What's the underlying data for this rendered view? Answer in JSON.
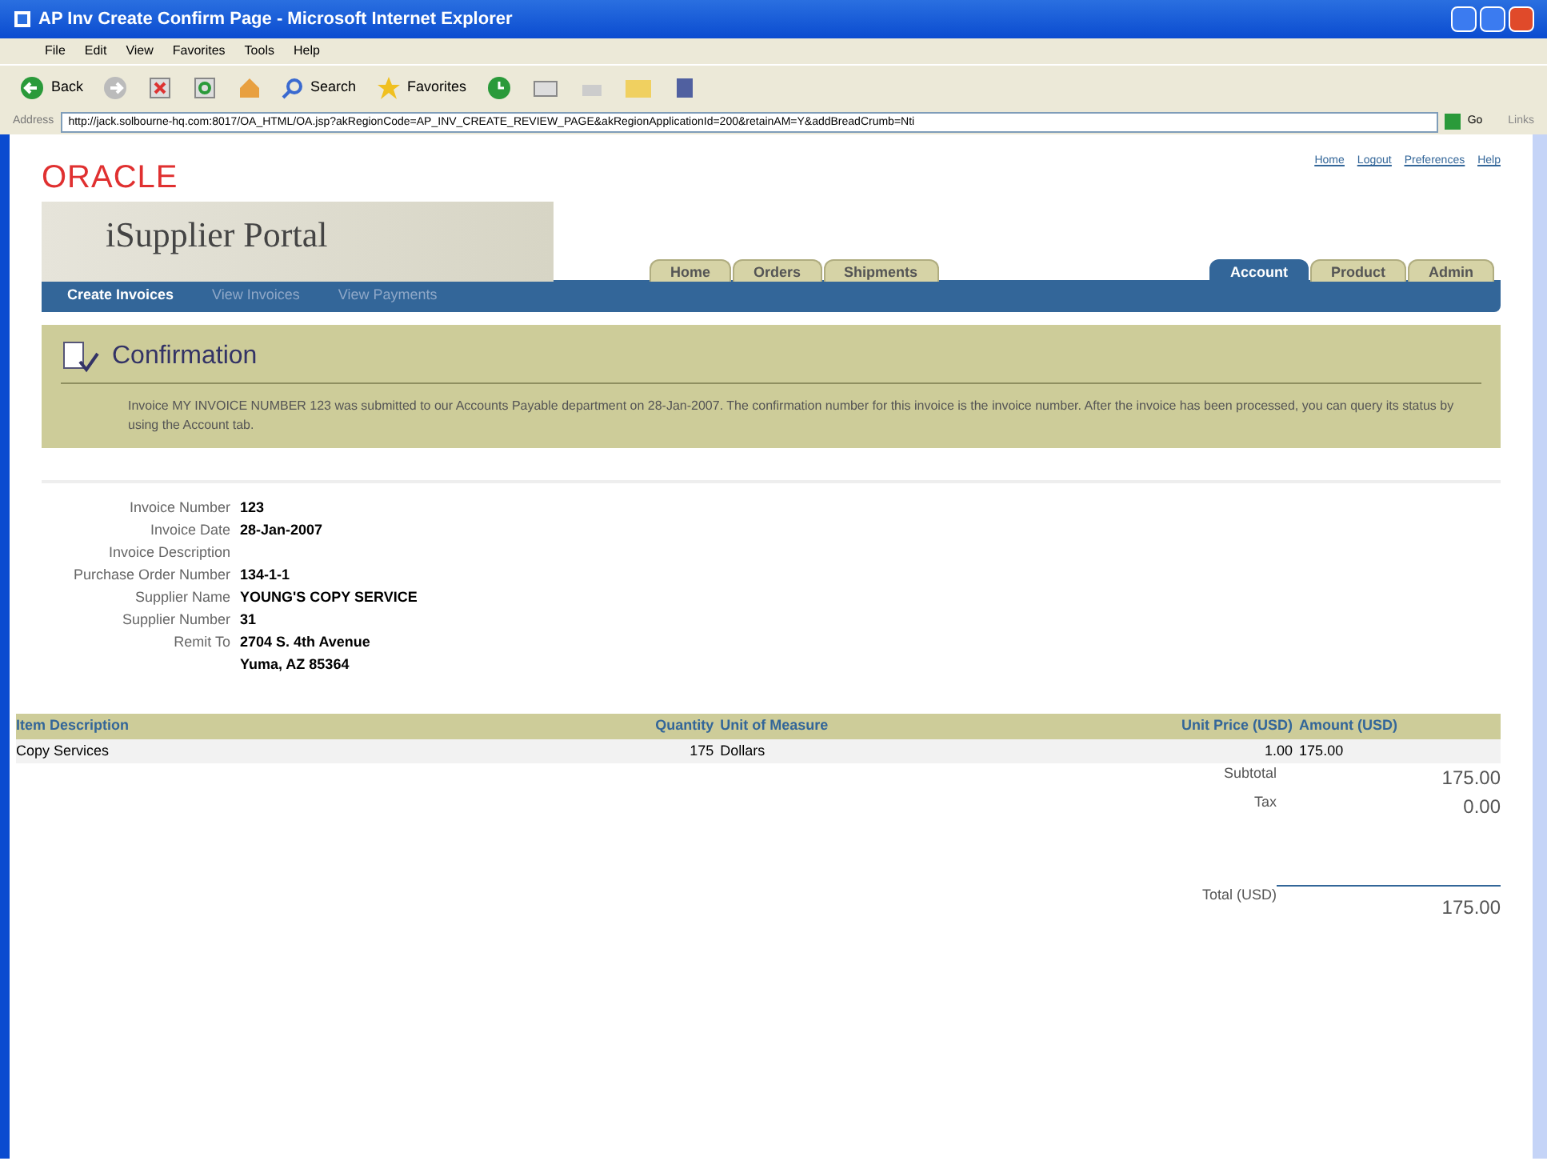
{
  "window": {
    "title": "AP Inv Create Confirm Page - Microsoft Internet Explorer"
  },
  "menu": [
    "File",
    "Edit",
    "View",
    "Favorites",
    "Tools",
    "Help"
  ],
  "toolbar": {
    "back": "Back",
    "search": "Search",
    "favorites": "Favorites"
  },
  "address_bar": {
    "label": "Address",
    "url": "http://jack.solbourne-hq.com:8017/OA_HTML/OA.jsp?akRegionCode=AP_INV_CREATE_REVIEW_PAGE&akRegionApplicationId=200&retainAM=Y&addBreadCrumb=Nti",
    "go": "Go",
    "links": "Links"
  },
  "brand": {
    "logo": "ORACLE",
    "product": "iSupplier Portal"
  },
  "global_links": [
    "Home",
    "Logout",
    "Preferences",
    "Help"
  ],
  "tabs_left": [
    {
      "label": "Home",
      "selected": false
    },
    {
      "label": "Orders",
      "selected": false
    },
    {
      "label": "Shipments",
      "selected": false
    }
  ],
  "tabs_right": [
    {
      "label": "Account",
      "selected": true
    },
    {
      "label": "Product",
      "selected": false
    },
    {
      "label": "Admin",
      "selected": false
    }
  ],
  "subtabs": [
    {
      "label": "Create Invoices",
      "selected": true
    },
    {
      "label": "View Invoices",
      "selected": false
    },
    {
      "label": "View Payments",
      "selected": false
    }
  ],
  "confirmation": {
    "title": "Confirmation",
    "message": "Invoice MY INVOICE NUMBER 123 was submitted to our Accounts Payable department on 28-Jan-2007. The confirmation number for this invoice is the invoice number. After the invoice has been processed, you can query its status by using the Account tab."
  },
  "details": [
    {
      "label": "Invoice Number",
      "value": "123"
    },
    {
      "label": "Invoice Date",
      "value": "28-Jan-2007"
    },
    {
      "label": "Invoice Description"
    },
    {
      "label": "Purchase Order Number",
      "value": "134-1-1"
    },
    {
      "label": "Supplier Name",
      "value": "YOUNG'S COPY SERVICE"
    },
    {
      "label": "Supplier Number",
      "value": "31"
    },
    {
      "label": "Remit To",
      "value": "2704 S. 4th Avenue"
    },
    {
      "value": "Yuma, AZ 85364"
    }
  ],
  "table": {
    "columns": [
      "Item Description",
      "Quantity",
      "Unit of Measure",
      "Unit Price (USD)",
      "Amount (USD)"
    ],
    "rows": [
      [
        "Copy Services",
        "175",
        "Dollars",
        "1.00",
        "175.00"
      ]
    ]
  },
  "totals": [
    {
      "label": "Subtotal",
      "value": "175.00"
    },
    {
      "label": "Tax",
      "value": "0.00"
    },
    {
      "label": "Total (USD)",
      "value": "175.00",
      "kind": "total"
    }
  ]
}
